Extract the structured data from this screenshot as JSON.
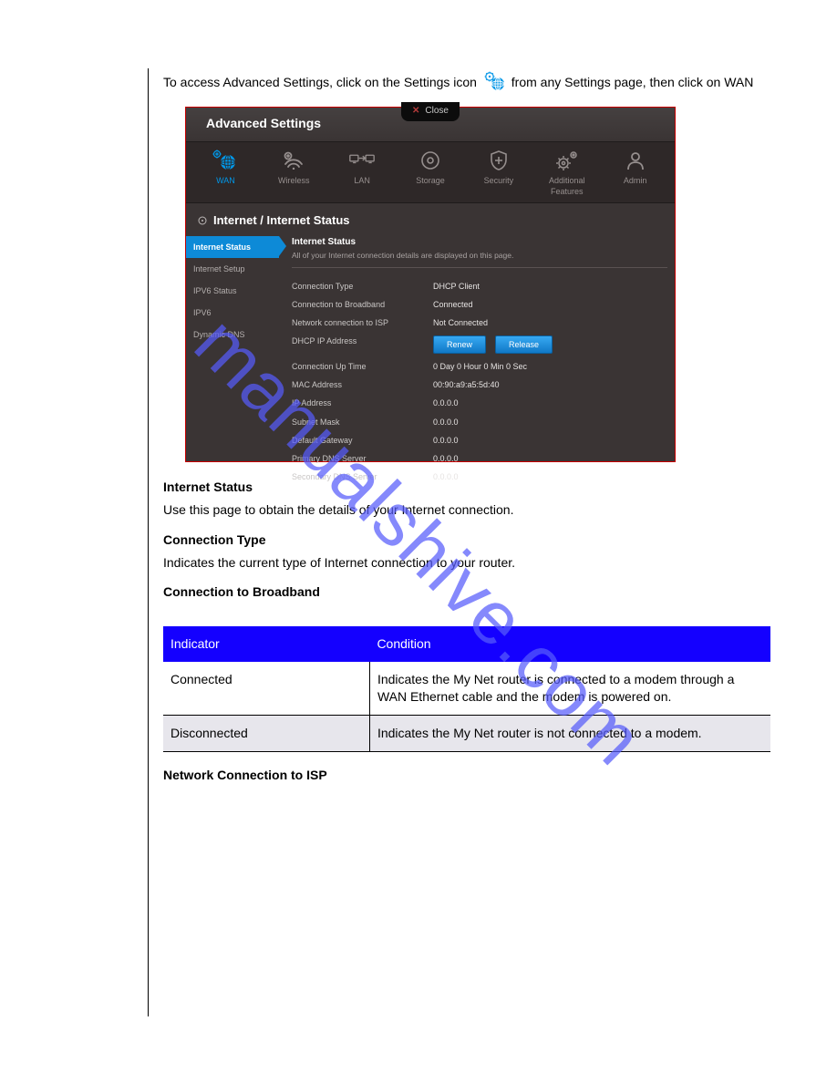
{
  "intro": {
    "line1": "To access Advanced Settings, click on the Settings icon",
    "line2": "from any Settings page, then click on WAN"
  },
  "router": {
    "close": "Close",
    "title": "Advanced Settings",
    "nav": [
      {
        "label": "WAN",
        "icon": "globe",
        "active": true
      },
      {
        "label": "Wireless",
        "icon": "wifi"
      },
      {
        "label": "LAN",
        "icon": "lan"
      },
      {
        "label": "Storage",
        "icon": "disc"
      },
      {
        "label": "Security",
        "icon": "shield"
      },
      {
        "label": "Additional Features",
        "icon": "gear"
      },
      {
        "label": "Admin",
        "icon": "person"
      }
    ],
    "page_title": "Internet / Internet Status",
    "sidebar": [
      {
        "label": "Internet Status",
        "active": true
      },
      {
        "label": "Internet Setup"
      },
      {
        "label": "IPV6 Status"
      },
      {
        "label": "IPV6"
      },
      {
        "label": "Dynamic DNS"
      }
    ],
    "panel": {
      "title": "Internet Status",
      "desc": "All of your Internet connection details are displayed on this page.",
      "rows": [
        {
          "label": "Connection Type",
          "value": "DHCP Client"
        },
        {
          "label": "Connection to Broadband",
          "value": "Connected"
        },
        {
          "label": "Network connection to ISP",
          "value": "Not Connected"
        },
        {
          "label": "DHCP IP Address",
          "buttons": true
        },
        {
          "label": "Connection Up Time",
          "value": "0 Day 0 Hour 0 Min 0 Sec"
        },
        {
          "label": "MAC Address",
          "value": "00:90:a9:a5:5d:40"
        },
        {
          "label": "IP Address",
          "value": "0.0.0.0"
        },
        {
          "label": "Subnet Mask",
          "value": "0.0.0.0"
        },
        {
          "label": "Default Gateway",
          "value": "0.0.0.0"
        },
        {
          "label": "Primary DNS Server",
          "value": "0.0.0.0"
        },
        {
          "label": "Secondary DNS Server",
          "value": "0.0.0.0"
        }
      ],
      "btn_renew": "Renew",
      "btn_release": "Release"
    }
  },
  "doc": {
    "sec_title": "Internet Status",
    "sec_body1": "Use this page to obtain the details of your Internet connection.",
    "sub1_title": "Connection Type",
    "sub1_body": "Indicates the current type of Internet connection to your router.",
    "sub2_title": "Connection to Broadband",
    "table_head1": "Indicator",
    "table_head2": "Condition",
    "t_r1_c1": "Connected",
    "t_r1_c2": "Indicates the My Net router is connected to a modem through a WAN Ethernet cable and the modem is powered on.",
    "t_r2_c1": "Disconnected",
    "t_r2_c2": "Indicates the My Net router is not connected to a modem.",
    "sub3_title": "Network Connection to ISP"
  }
}
